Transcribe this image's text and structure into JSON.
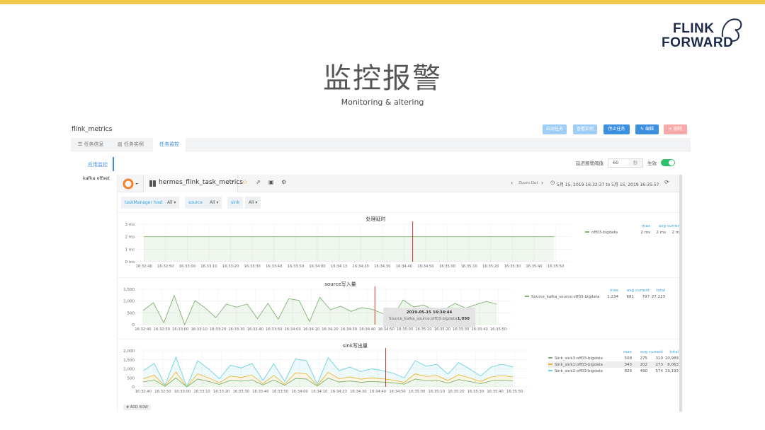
{
  "slide": {
    "title": "监控报警",
    "subtitle": "Monitoring & altering",
    "logo": [
      "FLINK",
      "FORWARD"
    ]
  },
  "app": {
    "name": "flink_metrics",
    "buttons": [
      {
        "label": "启动任务",
        "color": "#9fcdf6"
      },
      {
        "label": "查看实例",
        "color": "#9fcdf6"
      },
      {
        "label": "停止任务",
        "color": "#3d8fe0"
      },
      {
        "label": "✎ 编辑",
        "color": "#3d8fe0"
      },
      {
        "label": "✕ 删除",
        "color": "#f7a8a8"
      }
    ],
    "tabs": [
      "☰ 任务信息",
      "▥ 任务实例",
      "任务监控"
    ],
    "side": [
      "应用监控",
      "kafka offset"
    ],
    "threshold": {
      "label": "延迟报警阈值",
      "value": "60",
      "unit": "秒",
      "enable": "生效",
      "enabled": true
    }
  },
  "grafana": {
    "dashboard": "hermes_flink_task_metrics",
    "zoom_out": "Zoom Out",
    "time_range": "5月 15, 2019 16:32:37 to 5月 15, 2019 16:35:57",
    "vars": [
      {
        "label": "taskManager host",
        "value": "All ▾"
      },
      {
        "label": "source",
        "value": "All ▾"
      },
      {
        "label": "sink",
        "value": "All ▾"
      }
    ],
    "add_row": "✚ ADD ROW"
  },
  "chart_data": [
    {
      "type": "line",
      "title": "处理延时",
      "ylim": [
        0,
        3
      ],
      "yticks": [
        "0 ms",
        "1 ms",
        "2 ms",
        "3 ms"
      ],
      "ytickvals": [
        0,
        1,
        2,
        3
      ],
      "xticks": [
        "16:32:40",
        "16:32:50",
        "16:33:00",
        "16:33:10",
        "16:33:20",
        "16:33:30",
        "16:33:40",
        "16:33:50",
        "16:34:00",
        "16:34:13",
        "16:34:20",
        "16:34:30",
        "16:34:40",
        "16:34:50",
        "16:35:00",
        "16:35:10",
        "16:35:20",
        "16:35:30",
        "16:35:40",
        "16:35:50"
      ],
      "series": [
        {
          "name": "off03-bigdata",
          "color": "#7eb26d",
          "values": [
            2,
            2,
            2,
            2,
            2,
            2,
            2,
            2,
            2,
            2,
            2,
            2,
            2,
            2,
            2,
            2,
            2,
            2,
            2,
            2,
            2,
            2,
            2,
            2,
            2,
            2,
            2,
            2,
            2,
            2,
            2,
            2,
            2,
            2,
            2
          ],
          "max": "2 ms",
          "avg": "2 ms",
          "current": "2 ms"
        }
      ],
      "legend_cols": [
        "max",
        "avg",
        "current"
      ],
      "crosshair": "16:34:44"
    },
    {
      "type": "area",
      "title": "source写入量",
      "ylim": [
        0,
        1500
      ],
      "yticks": [
        "0",
        "500",
        "1,000",
        "1,500"
      ],
      "ytickvals": [
        0,
        500,
        1000,
        1500
      ],
      "xticks": [
        "16:32:40",
        "16:32:50",
        "16:33:00",
        "16:33:10",
        "16:33:20",
        "16:33:30",
        "16:33:40",
        "16:33:50",
        "16:34:00",
        "16:34:10",
        "16:34:20",
        "16:34:30",
        "16:34:40",
        "16:34:50",
        "16:35:00",
        "16:35:10",
        "16:35:20",
        "16:35:30",
        "16:35:40",
        "16:35:50"
      ],
      "series": [
        {
          "name": "Source_kafka_source:off03-bigdata",
          "color": "#7eb26d",
          "values": [
            600,
            930,
            80,
            1230,
            0,
            1020,
            700,
            300,
            870,
            740,
            870,
            260,
            900,
            230,
            1100,
            1030,
            130,
            1160,
            630,
            780,
            560,
            720,
            650,
            480,
            320,
            1050,
            750,
            830,
            600,
            650,
            900,
            700,
            850,
            980,
            870
          ],
          "max": "1,234",
          "avg": "681",
          "current": "797",
          "total": "27,223"
        }
      ],
      "legend_cols": [
        "max",
        "avg",
        "current",
        "total"
      ],
      "crosshair": "16:34:44",
      "tooltip": {
        "time": "2019-05-15 16:34:44",
        "series": "Source_kafka_source:off03-bigdata",
        "value": "1,050"
      }
    },
    {
      "type": "area",
      "stacked": true,
      "title": "sink写出量",
      "ylim": [
        0,
        2000
      ],
      "yticks": [
        "0",
        "500",
        "1,000",
        "1,500",
        "2,000"
      ],
      "ytickvals": [
        0,
        500,
        1000,
        1500,
        2000
      ],
      "xticks": [
        "16:32:40",
        "16:32:50",
        "16:33:00",
        "16:33:10",
        "16:33:20",
        "16:33:30",
        "16:33:40",
        "16:33:50",
        "16:34:00",
        "16:34:10",
        "16:34:23",
        "16:34:30",
        "16:34:40",
        "16:34:50",
        "16:35:00",
        "16:35:10",
        "16:35:20",
        "16:35:30",
        "16:35:40",
        "16:35:50"
      ],
      "series": [
        {
          "name": "Sink_sink3:off03-bigdata",
          "color": "#7eb26d",
          "values": [
            270,
            390,
            30,
            495,
            0,
            435,
            300,
            135,
            360,
            315,
            390,
            105,
            384,
            90,
            465,
            435,
            45,
            486,
            270,
            330,
            255,
            300,
            270,
            225,
            150,
            435,
            345,
            375,
            210,
            405,
            300,
            180,
            330,
            375,
            330
          ],
          "max": "508",
          "avg": "275",
          "current": "310",
          "total": "10,989"
        },
        {
          "name": "Sink_sink1:off03-bigdata",
          "color": "#eab839",
          "values": [
            180,
            260,
            20,
            330,
            0,
            290,
            200,
            90,
            240,
            210,
            260,
            70,
            256,
            60,
            310,
            290,
            30,
            324,
            180,
            220,
            170,
            200,
            180,
            150,
            100,
            290,
            230,
            250,
            140,
            270,
            200,
            120,
            220,
            250,
            220
          ],
          "max": "343",
          "avg": "202",
          "current": "273",
          "total": "8,063"
        },
        {
          "name": "Sink_sink2:off03-bigdata",
          "color": "#6ed0e0",
          "values": [
            450,
            650,
            50,
            825,
            0,
            725,
            500,
            225,
            600,
            525,
            650,
            175,
            640,
            150,
            775,
            725,
            75,
            810,
            450,
            550,
            425,
            500,
            450,
            375,
            250,
            725,
            575,
            625,
            350,
            675,
            500,
            300,
            550,
            625,
            550
          ],
          "max": "826",
          "avg": "480",
          "current": "574",
          "total": "19,193"
        }
      ],
      "legend_cols": [
        "max",
        "avg",
        "current",
        "total"
      ],
      "crosshair": "16:34:44"
    }
  ]
}
